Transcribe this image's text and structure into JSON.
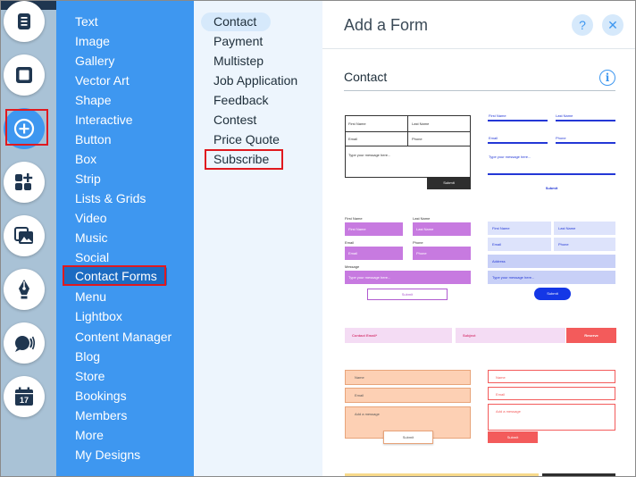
{
  "rail": {
    "icons": [
      "page-icon",
      "box-icon",
      "add-icon",
      "apps-icon",
      "media-icon",
      "pen-icon",
      "chat-icon",
      "calendar-icon"
    ],
    "calendar_day": "17"
  },
  "categories": [
    "Text",
    "Image",
    "Gallery",
    "Vector Art",
    "Shape",
    "Interactive",
    "Button",
    "Box",
    "Strip",
    "Lists & Grids",
    "Video",
    "Music",
    "Social",
    "Contact Forms",
    "Menu",
    "Lightbox",
    "Content Manager",
    "Blog",
    "Store",
    "Bookings",
    "Members",
    "More",
    "My Designs"
  ],
  "active_category": "Contact Forms",
  "subcategories": [
    "Contact",
    "Payment",
    "Multistep",
    "Job Application",
    "Feedback",
    "Contest",
    "Price Quote",
    "Subscribe"
  ],
  "active_subcategory": "Contact",
  "panel": {
    "title": "Add a Form",
    "help_icon": "?",
    "close_icon": "✕",
    "section_title": "Contact",
    "info_icon": "i"
  },
  "templates": {
    "t1": {
      "first": "First Name",
      "last": "Last Name",
      "email": "Email",
      "phone": "Phone",
      "message": "Type your message here...",
      "submit": "Submit"
    },
    "t2": {
      "first": "First Name",
      "last": "Last Name",
      "email": "Email",
      "phone": "Phone",
      "message": "Type your message here...",
      "submit": "Submit"
    },
    "t3": {
      "first_label": "First Name",
      "last_label": "Last Name",
      "first": "First Name",
      "last": "Last Name",
      "email_label": "Email",
      "phone_label": "Phone",
      "email": "Email",
      "phone": "Phone",
      "message_label": "Message",
      "message": "Type your message here...",
      "submit": "Submit"
    },
    "t4": {
      "first": "First Name",
      "last": "Last Name",
      "email": "Email",
      "phone": "Phone",
      "address": "Address",
      "message": "Type your message here...",
      "submit": "Submit"
    },
    "t5": {
      "email": "Contact Email*",
      "subject": "Subject",
      "submit": "Reserve"
    },
    "t6": {
      "name": "Name",
      "email": "Email",
      "message": "Add a message",
      "submit": "Submit"
    },
    "t7": {
      "name": "Name",
      "email": "Email",
      "message": "Add a message",
      "submit": "Submit"
    }
  },
  "colors": {
    "rail_bg": "#a9c2d6",
    "category_bg": "#3e97f0",
    "category_active": "#1c6bc2",
    "sub_bg": "#edf5fd",
    "highlight_red": "#e0191f",
    "form_blue": "#2438d6",
    "form_purple": "#c77ae0",
    "form_salmon": "#f35b5b",
    "form_peach": "#fdd0b4"
  }
}
